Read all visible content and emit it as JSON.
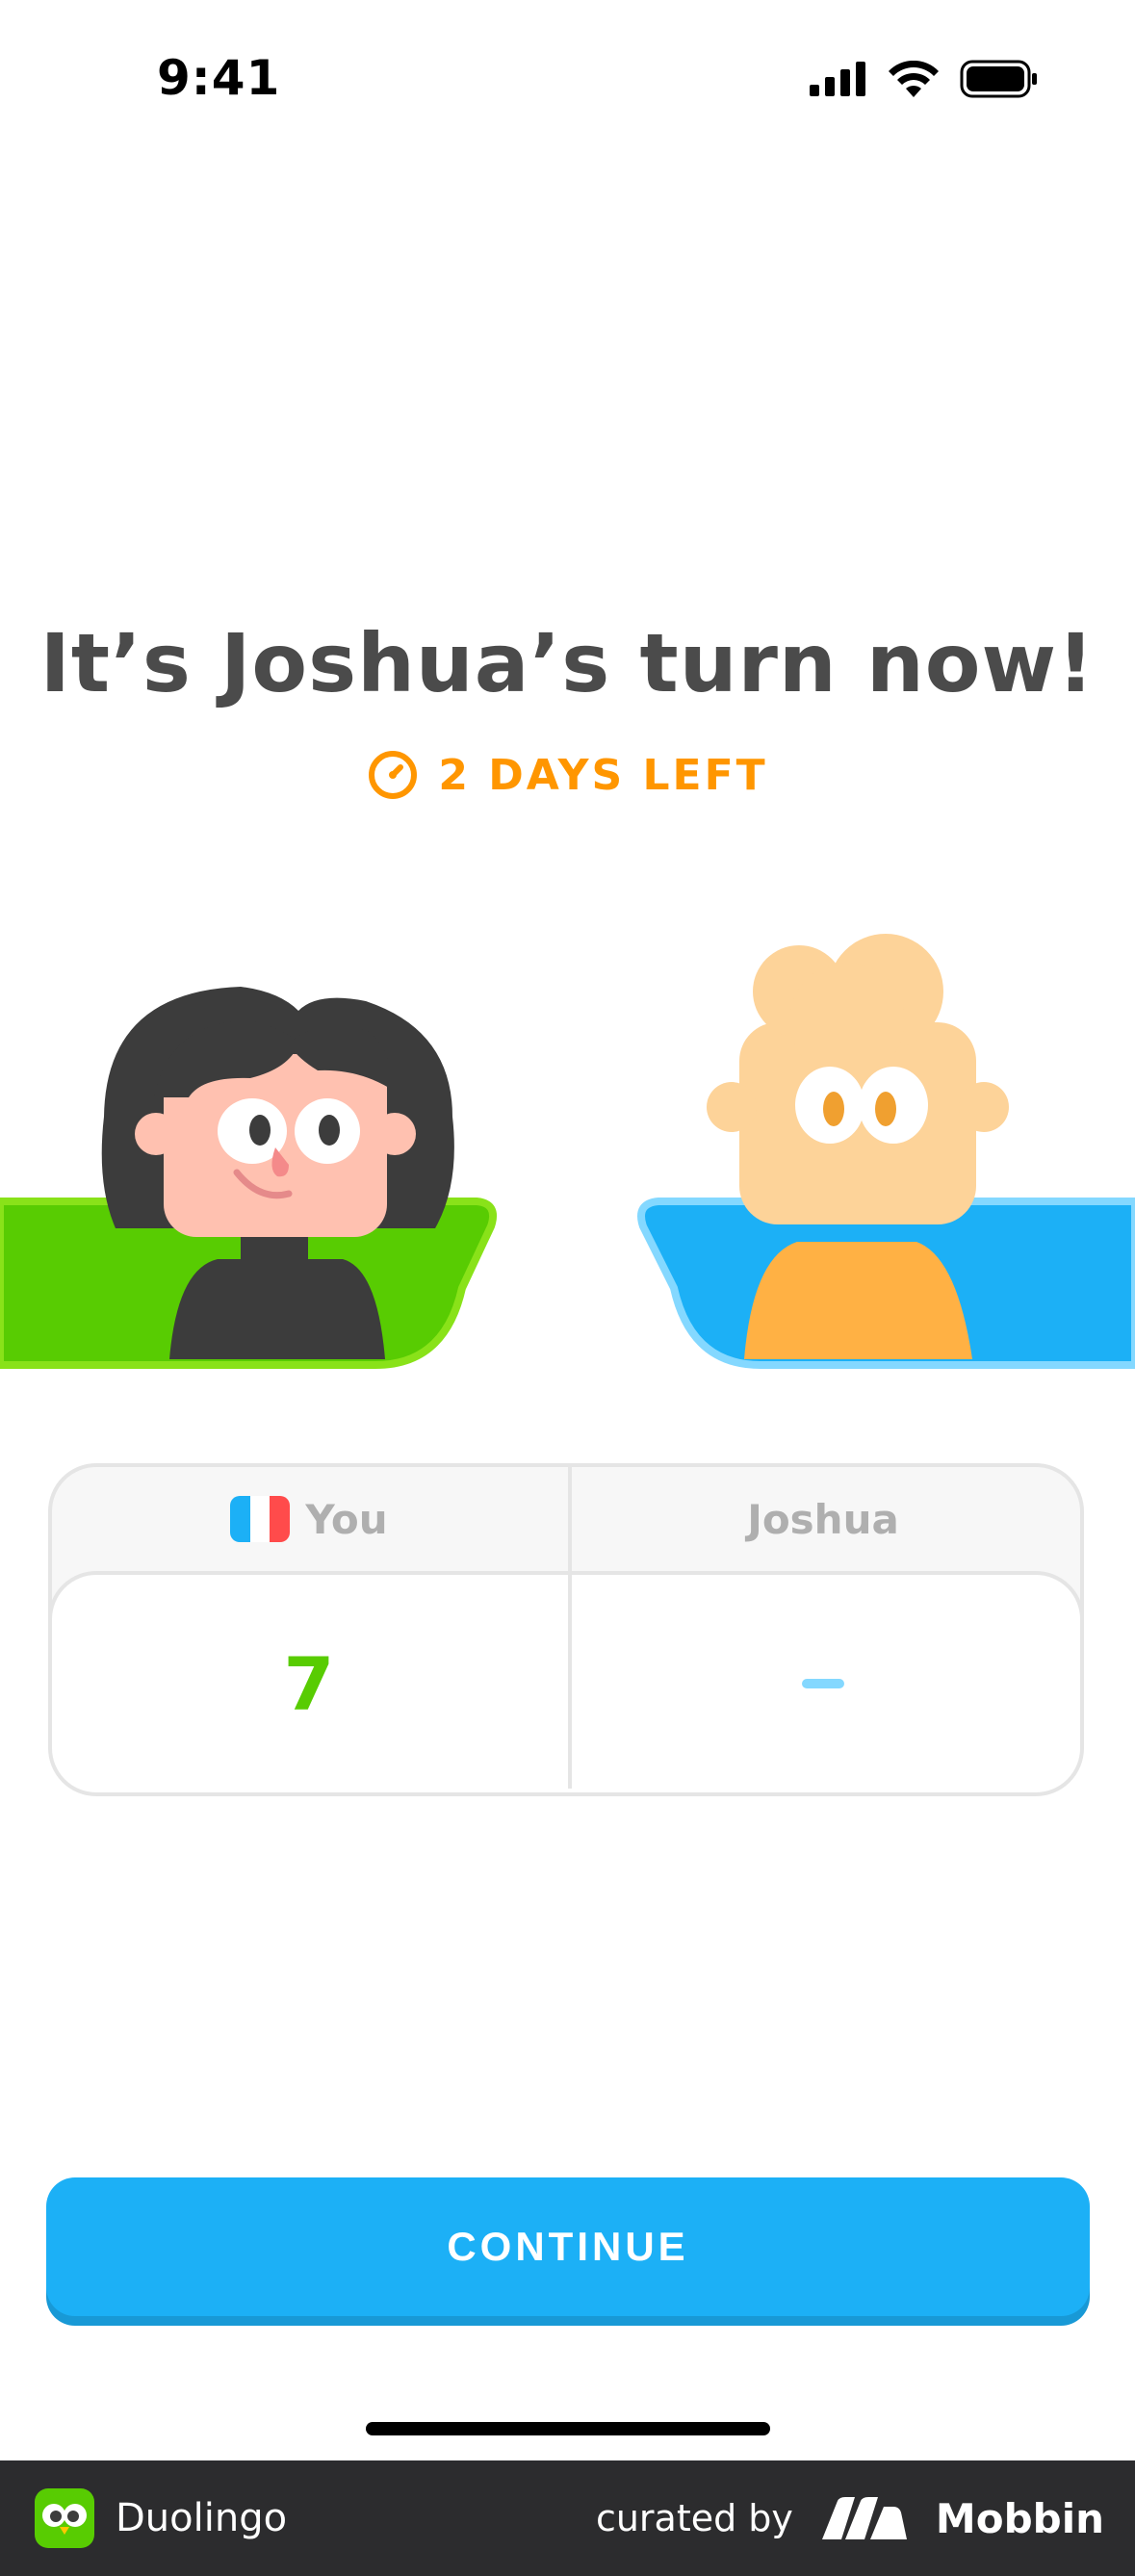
{
  "status_bar": {
    "time": "9:41"
  },
  "title": "It’s Joshua’s turn now!",
  "timer": {
    "label": "2 DAYS LEFT"
  },
  "scoreboard": {
    "you_label": "You",
    "opponent_label": "Joshua",
    "you_score": "7",
    "opponent_score": "–"
  },
  "continue_label": "CONTINUE",
  "footer": {
    "app_name": "Duolingo",
    "curated_by": "curated by",
    "brand": "Mobbin"
  },
  "colors": {
    "title": "#4b4b4b",
    "timer": "#ff9600",
    "you_green": "#58cc02",
    "opponent_blue": "#1cb0f6",
    "button": "#1cb0f6"
  }
}
